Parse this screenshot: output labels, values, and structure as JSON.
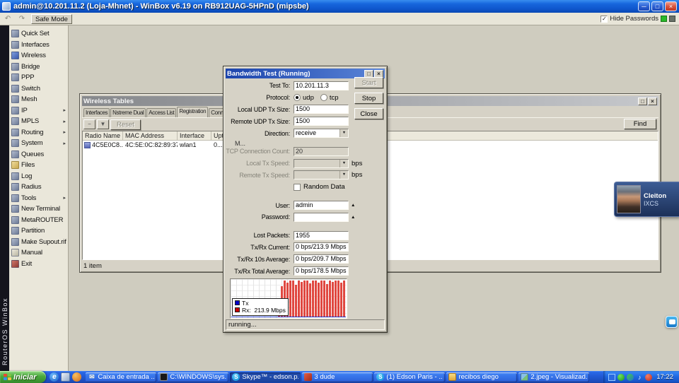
{
  "window": {
    "title": "admin@10.201.11.2 (Loja-Mhnet) - WinBox v6.19 on RB912UAG-5HPnD (mipsbe)"
  },
  "toolbar": {
    "safe_mode": "Safe Mode",
    "hide_passwords": "Hide Passwords",
    "hide_passwords_checked": true
  },
  "brand": {
    "vertical_text": "RouterOS WinBox"
  },
  "sidebar": {
    "items": [
      {
        "label": "Quick Set",
        "icon": "quick-set-icon",
        "submenu": false
      },
      {
        "label": "Interfaces",
        "icon": "interfaces-icon",
        "submenu": false
      },
      {
        "label": "Wireless",
        "icon": "wireless-icon",
        "submenu": false
      },
      {
        "label": "Bridge",
        "icon": "bridge-icon",
        "submenu": false
      },
      {
        "label": "PPP",
        "icon": "ppp-icon",
        "submenu": false
      },
      {
        "label": "Switch",
        "icon": "switch-icon",
        "submenu": false
      },
      {
        "label": "Mesh",
        "icon": "mesh-icon",
        "submenu": false
      },
      {
        "label": "IP",
        "icon": "ip-icon",
        "submenu": true
      },
      {
        "label": "MPLS",
        "icon": "mpls-icon",
        "submenu": true
      },
      {
        "label": "Routing",
        "icon": "routing-icon",
        "submenu": true
      },
      {
        "label": "System",
        "icon": "system-icon",
        "submenu": true
      },
      {
        "label": "Queues",
        "icon": "queues-icon",
        "submenu": false
      },
      {
        "label": "Files",
        "icon": "files-icon",
        "submenu": false
      },
      {
        "label": "Log",
        "icon": "log-icon",
        "submenu": false
      },
      {
        "label": "Radius",
        "icon": "radius-icon",
        "submenu": false
      },
      {
        "label": "Tools",
        "icon": "tools-icon",
        "submenu": true
      },
      {
        "label": "New Terminal",
        "icon": "terminal-icon",
        "submenu": false
      },
      {
        "label": "MetaROUTER",
        "icon": "metarouter-icon",
        "submenu": false
      },
      {
        "label": "Partition",
        "icon": "partition-icon",
        "submenu": false
      },
      {
        "label": "Make Supout.rif",
        "icon": "supout-icon",
        "submenu": false
      },
      {
        "label": "Manual",
        "icon": "manual-icon",
        "submenu": false
      },
      {
        "label": "Exit",
        "icon": "exit-icon",
        "submenu": false
      }
    ]
  },
  "wireless_window": {
    "title": "Wireless Tables",
    "tabs": [
      {
        "label": "Interfaces",
        "active": false
      },
      {
        "label": "Nstreme Dual",
        "active": false
      },
      {
        "label": "Access List",
        "active": false
      },
      {
        "label": "Registration",
        "active": true
      },
      {
        "label": "Connect List",
        "active": false
      }
    ],
    "reset_button": "Reset",
    "find_button": "Find",
    "columns": [
      "Radio Name",
      "MAC Address",
      "Interface",
      "Upti..."
    ],
    "row": {
      "radio_name": "4C5E0C8...",
      "mac_address": "4C:5E:0C:82:89:37",
      "interface": "wlan1",
      "uptime": "0..."
    },
    "status": "1 item"
  },
  "bandwidth_dialog": {
    "title": "Bandwidth Test (Running)",
    "buttons": {
      "start": "Start",
      "stop": "Stop",
      "close": "Close"
    },
    "rows": [
      {
        "type": "input",
        "label": "Test To:",
        "value": "10.201.11.3"
      },
      {
        "type": "radio",
        "label": "Protocol:",
        "options": [
          {
            "label": "udp",
            "selected": true
          },
          {
            "label": "tcp",
            "selected": false
          }
        ]
      },
      {
        "type": "input",
        "label": "Local UDP Tx Size:",
        "value": "1500"
      },
      {
        "type": "input",
        "label": "Remote UDP Tx Size:",
        "value": "1500"
      },
      {
        "type": "combo",
        "label": "Direction:",
        "value": "receive"
      },
      {
        "type": "separator"
      },
      {
        "type": "input",
        "label": "TCP Connection Count:",
        "value": "20",
        "disabled": true
      },
      {
        "type": "combo",
        "label": "Local Tx Speed:",
        "value": "",
        "disabled": true,
        "suffix": "bps"
      },
      {
        "type": "combo",
        "label": "Remote Tx Speed:",
        "value": "",
        "disabled": true,
        "suffix": "bps"
      },
      {
        "type": "checkbox",
        "label": "Random Data",
        "checked": false
      },
      {
        "type": "separator"
      },
      {
        "type": "input",
        "label": "User:",
        "value": "admin",
        "uparrow": true
      },
      {
        "type": "input",
        "label": "Password:",
        "value": "",
        "uparrow": true
      },
      {
        "type": "separator"
      },
      {
        "type": "readonly",
        "label": "Lost Packets:",
        "value": "1955"
      },
      {
        "type": "readonly",
        "label": "Tx/Rx Current:",
        "value": "0 bps/213.9 Mbps"
      },
      {
        "type": "readonly",
        "label": "Tx/Rx 10s Average:",
        "value": "0 bps/209.7 Mbps"
      },
      {
        "type": "readonly",
        "label": "Tx/Rx Total Average:",
        "value": "0 bps/178.5 Mbps"
      }
    ],
    "graph": {
      "legend": [
        {
          "label": "Tx",
          "color": "#0000c8"
        },
        {
          "label": "Rx:  213.9 Mbps",
          "color": "#c80000"
        }
      ],
      "bars": [
        30,
        85,
        100,
        95,
        100,
        100,
        88,
        100,
        96,
        100,
        100,
        92,
        100,
        100,
        95,
        100,
        100,
        90,
        100,
        97,
        100,
        100,
        94,
        100
      ]
    },
    "artifact": "M...",
    "status": "running..."
  },
  "overlay_card": {
    "line1": "Cleiton",
    "line2": "IXCS"
  },
  "taskbar": {
    "start_label": "Iniciar",
    "quick_launch": [
      {
        "icon": "internet-explorer-icon"
      },
      {
        "icon": "show-desktop-icon"
      },
      {
        "icon": "media-player-icon"
      }
    ],
    "buttons": [
      {
        "label": "Caixa de entrada ...",
        "icon": "envelope-icon",
        "pressed": false
      },
      {
        "label": "C:\\WINDOWS\\sys...",
        "icon": "console-icon",
        "pressed": false
      },
      {
        "label": "Skype™ - edson.p...",
        "icon": "skype-icon",
        "pressed": true
      },
      {
        "label": "3 dude",
        "icon": "app-red-icon",
        "pressed": false
      },
      {
        "label": "(1) Edson Paris - ...",
        "icon": "skype-chat-icon",
        "pressed": false
      },
      {
        "label": "recibos diego",
        "icon": "folder-icon",
        "pressed": false
      },
      {
        "label": "2.jpeg - Visualizad...",
        "icon": "image-viewer-icon",
        "pressed": false
      }
    ],
    "tray": {
      "icons": [
        "tray-blue-icon",
        "tray-skype-icon",
        "tray-msn-icon",
        "tray-volume-icon",
        "tray-red-icon"
      ],
      "clock": "17:22"
    }
  }
}
